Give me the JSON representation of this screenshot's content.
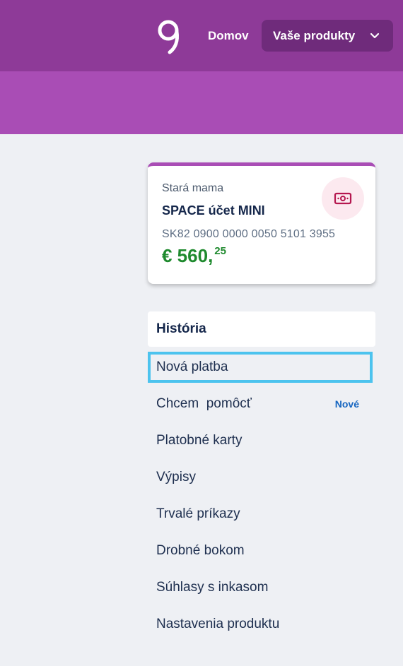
{
  "header": {
    "home_label": "Domov",
    "products_label": "Vaše produkty"
  },
  "account_card": {
    "owner": "Stará mama",
    "name": "SPACE účet MINI",
    "iban": "SK82 0900 0000 0050 5101 3955",
    "amount_main": "€ 560,",
    "amount_cents": "25"
  },
  "menu": {
    "heading": "História",
    "items": [
      {
        "label": "Nová platba",
        "badge": ""
      },
      {
        "label": "Chcem  pomôcť",
        "badge": "Nové"
      },
      {
        "label": "Platobné karty",
        "badge": ""
      },
      {
        "label": "Výpisy",
        "badge": ""
      },
      {
        "label": "Trvalé príkazy",
        "badge": ""
      },
      {
        "label": "Drobné bokom",
        "badge": ""
      },
      {
        "label": "Súhlasy s inkasom",
        "badge": ""
      },
      {
        "label": "Nastavenia produktu",
        "badge": ""
      }
    ]
  },
  "colors": {
    "header_bg": "#8e3a98",
    "hero_bg": "#a94db5",
    "amount": "#1f8a2e",
    "focus_ring": "#4cc3ee",
    "badge_new": "#1565c0"
  },
  "icons": [
    "logo-icon",
    "chevron-down-icon",
    "money-icon"
  ]
}
